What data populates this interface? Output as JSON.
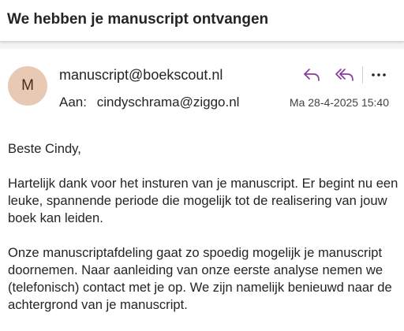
{
  "subject": "We hebben je manuscript ontvangen",
  "sender": {
    "initial": "M",
    "email": "manuscript@boekscout.nl",
    "avatar_color": "#e8c9b4"
  },
  "recipient": {
    "label": "Aan:",
    "email": "cindyschrama@ziggo.nl"
  },
  "date": "Ma 28-4-2025 15:40",
  "actions": {
    "icons": [
      "reply-icon",
      "reply-all-icon",
      "more-icon"
    ],
    "accent_color": "#8a3b9e"
  },
  "body": {
    "greeting": "Beste Cindy,",
    "paragraph1": "Hartelijk dank voor het insturen van je manuscript. Er begint nu een leuke, spannende periode die mogelijk tot de realisering van jouw boek kan leiden.",
    "paragraph2": "Onze manuscriptafdeling gaat zo spoedig mogelijk je manuscript doornemen. Naar aanleiding van onze eerste analyse nemen we (telefonisch) contact met je op. We zijn namelijk benieuwd naar de achtergrond van je manuscript."
  }
}
